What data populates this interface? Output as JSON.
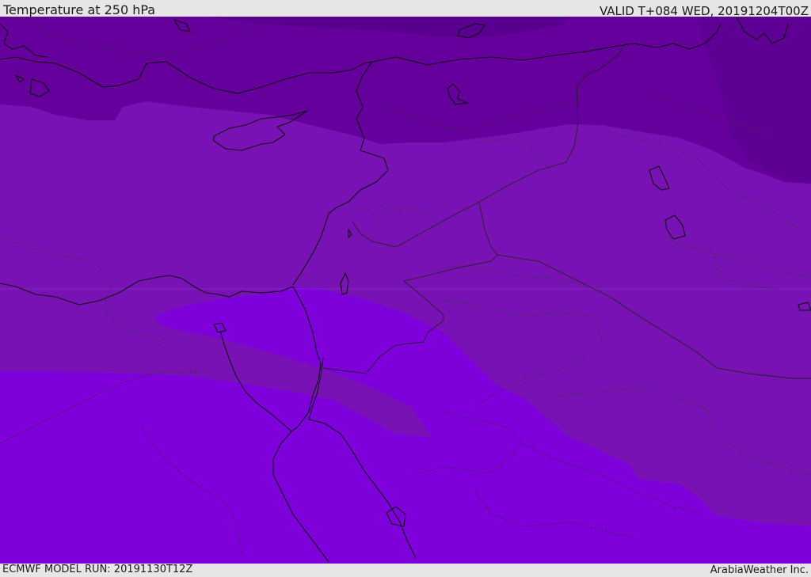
{
  "header": {
    "title": "Temperature at 250 hPa",
    "valid": "VALID T+084 WED, 20191204T00Z"
  },
  "footer": {
    "model_run": "ECMWF MODEL RUN: 20191130T12Z",
    "credit": "ArabiaWeather Inc."
  },
  "map": {
    "colors": {
      "coldest_band": "#5a0090",
      "cold_band": "#66009c",
      "mid_band": "#7812b4",
      "warm_band": "#7e00db",
      "coastline": "#111111",
      "border": "#222222"
    }
  }
}
